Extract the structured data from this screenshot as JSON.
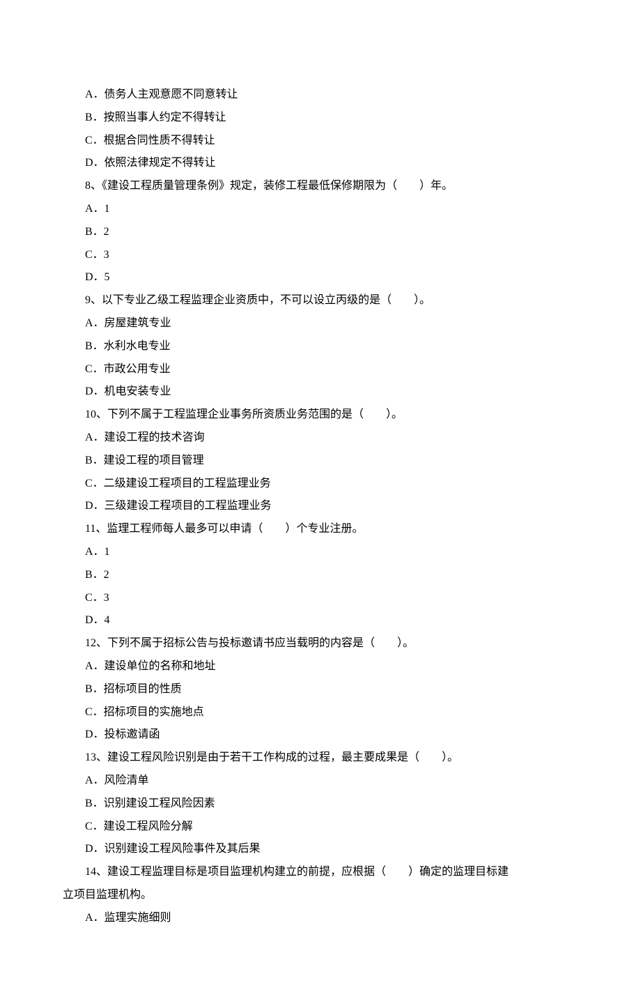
{
  "lines": [
    "A．债务人主观意愿不同意转让",
    "B．按照当事人约定不得转让",
    "C．根据合同性质不得转让",
    "D．依照法律规定不得转让",
    "8、《建设工程质量管理条例》规定，装修工程最低保修期限为（　　）年。",
    "A．1",
    "B．2",
    "C．3",
    "D．5",
    "9、以下专业乙级工程监理企业资质中，不可以设立丙级的是（　　）。",
    "A．房屋建筑专业",
    "B．水利水电专业",
    "C．市政公用专业",
    "D．机电安装专业",
    "10、下列不属于工程监理企业事务所资质业务范围的是（　　）。",
    "A．建设工程的技术咨询",
    "B．建设工程的项目管理",
    "C．二级建设工程项目的工程监理业务",
    "D．三级建设工程项目的工程监理业务",
    "11、监理工程师每人最多可以申请（　　）个专业注册。",
    "A．1",
    "B．2",
    "C．3",
    "D．4",
    "12、下列不属于招标公告与投标邀请书应当载明的内容是（　　）。",
    "A．建设单位的名称和地址",
    "B．招标项目的性质",
    "C．招标项目的实施地点",
    "D．投标邀请函",
    "13、建设工程风险识别是由于若干工作构成的过程，最主要成果是（　　）。",
    "A．风险清单",
    "B．识别建设工程风险因素",
    "C．建设工程风险分解",
    "D．识别建设工程风险事件及其后果",
    "14、建设工程监理目标是项目监理机构建立的前提，应根据（　　）确定的监理目标建"
  ],
  "line_q14_cont": "立项目监理机构。",
  "line_q14_a": "A．监理实施细则"
}
